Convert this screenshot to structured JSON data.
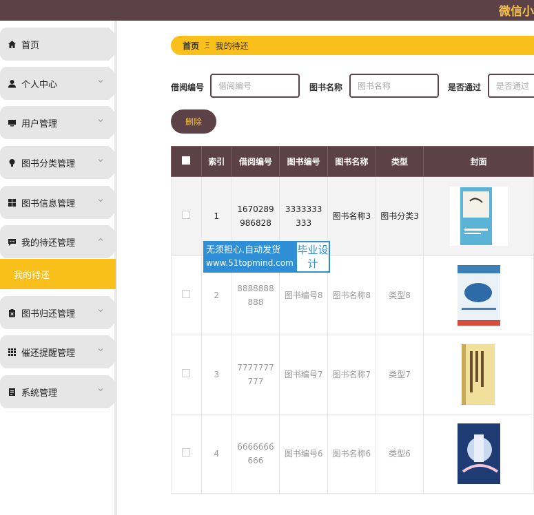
{
  "header": {
    "title": "微信小"
  },
  "sidebar": {
    "items": [
      {
        "label": "首页",
        "icon": "home-icon",
        "chevron": false
      },
      {
        "label": "个人中心",
        "icon": "user-icon",
        "chevron": true
      },
      {
        "label": "用户管理",
        "icon": "monitor-icon",
        "chevron": true
      },
      {
        "label": "图书分类管理",
        "icon": "bulb-icon",
        "chevron": true
      },
      {
        "label": "图书信息管理",
        "icon": "grid-icon",
        "chevron": true
      },
      {
        "label": "我的待还管理",
        "icon": "chat-icon",
        "chevron": true,
        "expanded": true
      },
      {
        "label": "图书归还管理",
        "icon": "clipboard-icon",
        "chevron": true
      },
      {
        "label": "催还提醒管理",
        "icon": "apps-icon",
        "chevron": true
      },
      {
        "label": "系统管理",
        "icon": "doc-icon",
        "chevron": true
      }
    ],
    "subitem": {
      "label": "我的待还"
    }
  },
  "breadcrumb": {
    "home": "首页",
    "separator": "Ξ",
    "current": "我的待还"
  },
  "search": {
    "borrow_no": {
      "label": "借阅编号",
      "placeholder": "借阅编号"
    },
    "book_name": {
      "label": "图书名称",
      "placeholder": "图书名称"
    },
    "approved": {
      "label": "是否通过",
      "placeholder": "是否通过"
    }
  },
  "actions": {
    "delete": "删除"
  },
  "table": {
    "headers": [
      "索引",
      "借阅编号",
      "图书编号",
      "图书名称",
      "类型",
      "封面"
    ],
    "rows": [
      {
        "index": "1",
        "borrow_no": "1670289986828",
        "book_no": "3333333333",
        "book_name": "图书名称3",
        "type": "图书分类3",
        "cover": "cover-1"
      },
      {
        "index": "2",
        "borrow_no": "8888888888",
        "book_no": "图书编号8",
        "book_name": "图书名称8",
        "type": "类型8",
        "cover": "cover-2"
      },
      {
        "index": "3",
        "borrow_no": "7777777777",
        "book_no": "图书编号7",
        "book_name": "图书名称7",
        "type": "类型7",
        "cover": "cover-3"
      },
      {
        "index": "4",
        "borrow_no": "6666666666",
        "book_no": "图书编号6",
        "book_name": "图书名称6",
        "type": "类型6",
        "cover": "cover-4"
      }
    ]
  },
  "watermark": {
    "line1": "无须担心.自动发货",
    "line2": "www.51topmind.com",
    "badge": "毕业设计"
  },
  "colors": {
    "primary": "#5c4246",
    "accent": "#f9bf1b",
    "watermark": "#2e8fd6"
  }
}
